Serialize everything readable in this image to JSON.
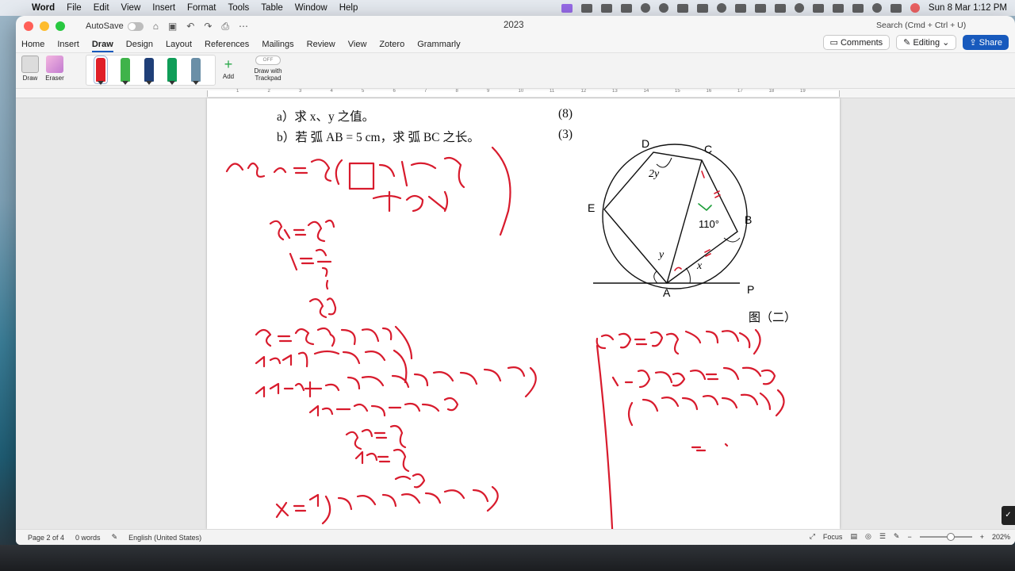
{
  "menubar": {
    "app": "Word",
    "items": [
      "File",
      "Edit",
      "View",
      "Insert",
      "Format",
      "Tools",
      "Table",
      "Window",
      "Help"
    ],
    "clock": "Sun 8 Mar  1:12 PM"
  },
  "titlebar": {
    "autosave": "AutoSave",
    "doc_title": "2023",
    "search_placeholder": "Search (Cmd + Ctrl + U)"
  },
  "ribbon_tabs": [
    "Home",
    "Insert",
    "Draw",
    "Design",
    "Layout",
    "References",
    "Mailings",
    "Review",
    "View",
    "Zotero",
    "Grammarly"
  ],
  "active_tab": "Draw",
  "buttons": {
    "comments": "Comments",
    "editing": "Editing",
    "share": "Share"
  },
  "draw_ribbon": {
    "draw": "Draw",
    "eraser": "Eraser",
    "add": "Add",
    "trackpad_toggle": "OFF",
    "trackpad_label_1": "Draw with",
    "trackpad_label_2": "Trackpad",
    "pen_colors": [
      "#e0202a",
      "#3fb34a",
      "#1f3f78",
      "#0f9d58",
      "#6a8fa7"
    ]
  },
  "ruler_numbers": [
    "1",
    "2",
    "3",
    "4",
    "5",
    "6",
    "7",
    "8",
    "9",
    "10",
    "11",
    "12",
    "13",
    "14",
    "15",
    "16",
    "17",
    "18",
    "19"
  ],
  "document": {
    "line_a": "a）求 x、y 之值。",
    "marks_a": "(8)",
    "line_b": "b）若 弧 AB = 5 cm，求 弧 BC 之长。",
    "marks_b": "(3)",
    "figure_caption": "图（二）",
    "figure_labels": {
      "D": "D",
      "C": "C",
      "E": "E",
      "B": "B",
      "A": "A",
      "P": "P",
      "angle_D": "2y",
      "angle_B": "110°",
      "angle_y": "y",
      "angle_x": "x"
    },
    "ink_color": "#d81b2d",
    "ink_green": "#1e9e3a"
  },
  "statusbar": {
    "page": "Page 2 of 4",
    "words": "0 words",
    "language": "English (United States)",
    "focus": "Focus",
    "zoom": "202%"
  }
}
